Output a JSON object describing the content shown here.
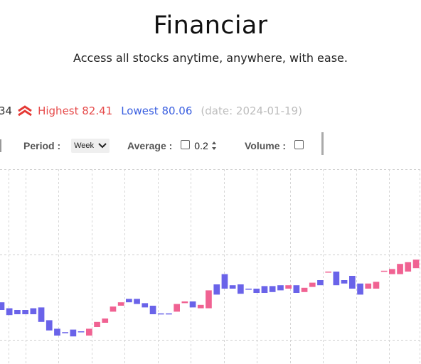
{
  "header": {
    "title": "Financiar",
    "subtitle": "Access all stocks anytime, anywhere, with ease."
  },
  "stats": {
    "last_value_fragment": "34",
    "highest_label": "Highest 82.41",
    "lowest_label": "Lowest 80.06",
    "date_label": "(date: 2024-01-19)",
    "highest_color": "#e64b4b",
    "lowest_color": "#3a5fe0",
    "trend_icon": "double-chevron-up-icon"
  },
  "controls": {
    "period_label": "Period :",
    "period_value": "Week",
    "average_label": "Average :",
    "average_value": "0.2",
    "average_checked": false,
    "volume_label": "Volume :",
    "volume_checked": false
  },
  "chart_data": {
    "type": "candlestick",
    "up_color": "#f06292",
    "down_color": "#6a63e9",
    "grid": true,
    "y_reference": [
      {
        "label": "upper",
        "value": 100
      },
      {
        "label": "lower",
        "value": 0
      }
    ],
    "candles": [
      {
        "dir": "down",
        "open": 44,
        "close": 35
      },
      {
        "dir": "down",
        "open": 37,
        "close": 29
      },
      {
        "dir": "down",
        "open": 35,
        "close": 30
      },
      {
        "dir": "down",
        "open": 35,
        "close": 30
      },
      {
        "dir": "down",
        "open": 37,
        "close": 30
      },
      {
        "dir": "down",
        "open": 38,
        "close": 21
      },
      {
        "dir": "down",
        "open": 23,
        "close": 11
      },
      {
        "dir": "down",
        "open": 13,
        "close": 5
      },
      {
        "dir": "down",
        "open": 9,
        "close": 8
      },
      {
        "dir": "down",
        "open": 12,
        "close": 4
      },
      {
        "dir": "down",
        "open": 10,
        "close": 9
      },
      {
        "dir": "up",
        "open": 5,
        "close": 13
      },
      {
        "dir": "up",
        "open": 15,
        "close": 21
      },
      {
        "dir": "up",
        "open": 20,
        "close": 25
      },
      {
        "dir": "up",
        "open": 33,
        "close": 39
      },
      {
        "dir": "up",
        "open": 40,
        "close": 44
      },
      {
        "dir": "down",
        "open": 48,
        "close": 44
      },
      {
        "dir": "down",
        "open": 48,
        "close": 42
      },
      {
        "dir": "down",
        "open": 43,
        "close": 38
      },
      {
        "dir": "down",
        "open": 40,
        "close": 30
      },
      {
        "dir": "down",
        "open": 31,
        "close": 30
      },
      {
        "dir": "down",
        "open": 31,
        "close": 30
      },
      {
        "dir": "up",
        "open": 33,
        "close": 42
      },
      {
        "dir": "up",
        "open": 43,
        "close": 45
      },
      {
        "dir": "down",
        "open": 45,
        "close": 38
      },
      {
        "dir": "up",
        "open": 37,
        "close": 41
      },
      {
        "dir": "up",
        "open": 37,
        "close": 58
      },
      {
        "dir": "down",
        "open": 65,
        "close": 53
      },
      {
        "dir": "down",
        "open": 77,
        "close": 60
      },
      {
        "dir": "down",
        "open": 64,
        "close": 60
      },
      {
        "dir": "down",
        "open": 65,
        "close": 54
      },
      {
        "dir": "down",
        "open": 60,
        "close": 59
      },
      {
        "dir": "down",
        "open": 60,
        "close": 55
      },
      {
        "dir": "down",
        "open": 63,
        "close": 55
      },
      {
        "dir": "down",
        "open": 63,
        "close": 56
      },
      {
        "dir": "down",
        "open": 64,
        "close": 58
      },
      {
        "dir": "up",
        "open": 60,
        "close": 64
      },
      {
        "dir": "down",
        "open": 64,
        "close": 55
      },
      {
        "dir": "up",
        "open": 56,
        "close": 61
      },
      {
        "dir": "up",
        "open": 62,
        "close": 67
      },
      {
        "dir": "down",
        "open": 70,
        "close": 64
      },
      {
        "dir": "up",
        "open": 79,
        "close": 80
      },
      {
        "dir": "down",
        "open": 80,
        "close": 64
      },
      {
        "dir": "down",
        "open": 70,
        "close": 66
      },
      {
        "dir": "down",
        "open": 75,
        "close": 60
      },
      {
        "dir": "down",
        "open": 66,
        "close": 53
      },
      {
        "dir": "up",
        "open": 60,
        "close": 66
      },
      {
        "dir": "up",
        "open": 60,
        "close": 68
      },
      {
        "dir": "up",
        "open": 80,
        "close": 81
      },
      {
        "dir": "up",
        "open": 77,
        "close": 83
      },
      {
        "dir": "up",
        "open": 77,
        "close": 89
      },
      {
        "dir": "up",
        "open": 80,
        "close": 91
      },
      {
        "dir": "up",
        "open": 84,
        "close": 94
      }
    ]
  }
}
